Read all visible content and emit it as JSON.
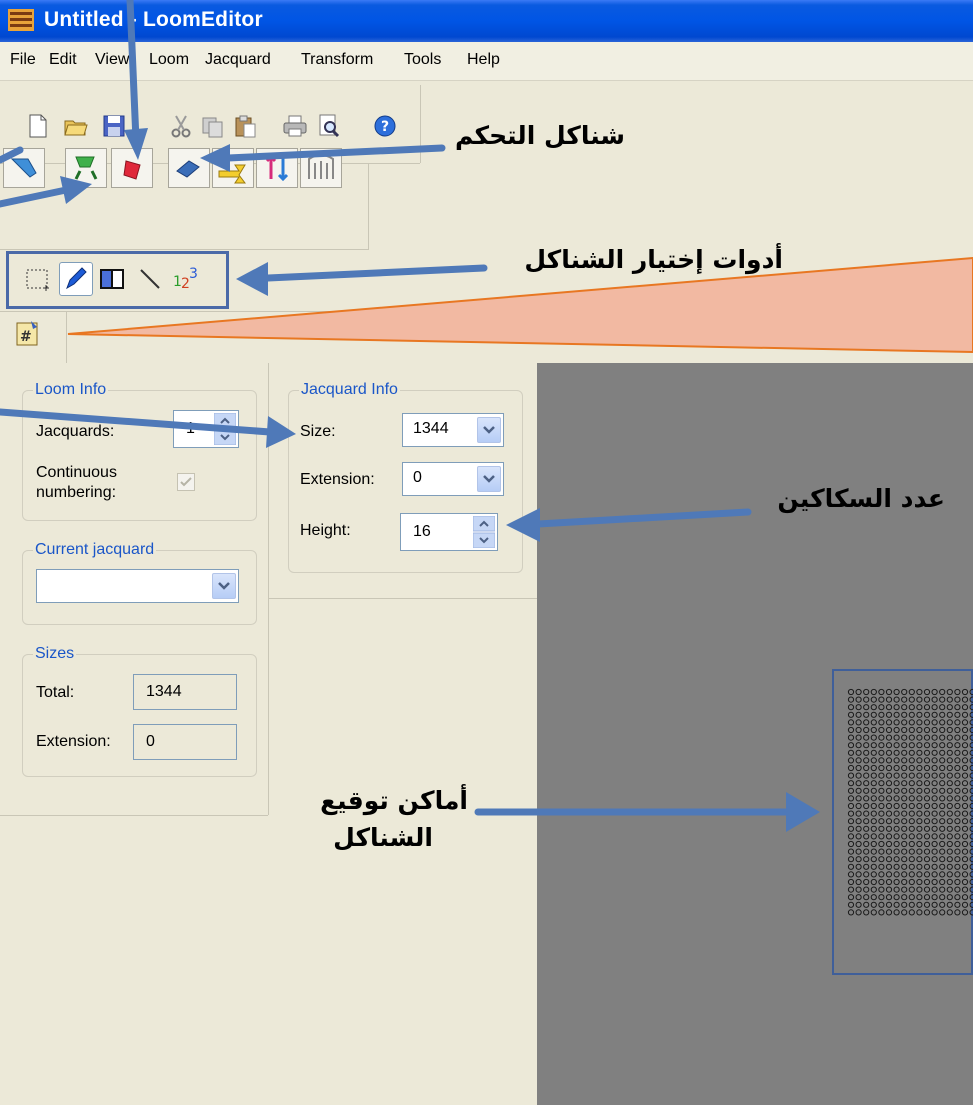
{
  "window": {
    "title": "Untitled - LoomEditor"
  },
  "menu": [
    "File",
    "Edit",
    "View",
    "Loom",
    "Jacquard",
    "Transform",
    "Tools",
    "Help"
  ],
  "loom_info": {
    "legend": "Loom Info",
    "jacquards_label": "Jacquards:",
    "jacquards_value": "1",
    "continuous_label_1": "Continuous",
    "continuous_label_2": "numbering:"
  },
  "current_jacquard": {
    "legend": "Current jacquard",
    "value": ""
  },
  "sizes": {
    "legend": "Sizes",
    "total_label": "Total:",
    "total_value": "1344",
    "extension_label": "Extension:",
    "extension_value": "0"
  },
  "jacquard_info": {
    "legend": "Jacquard Info",
    "size_label": "Size:",
    "size_value": "1344",
    "extension_label": "Extension:",
    "extension_value": "0",
    "height_label": "Height:",
    "height_value": "16"
  },
  "annotations": {
    "control_shapes": "شناكل التحكم",
    "selection_tools": "أدوات إختيار الشناكل",
    "knife_count": "عدد السكاكين",
    "placement_line1": "أماكن توقيع",
    "placement_line2": "الشناكل"
  },
  "colors": {
    "title_bar": "#0055e5",
    "canvas": "#808080",
    "arrow": "#4f79b8",
    "highlight_wedge": "#f2b9a2",
    "highlight_edge": "#e87722",
    "group_legend": "#1a56c8"
  }
}
